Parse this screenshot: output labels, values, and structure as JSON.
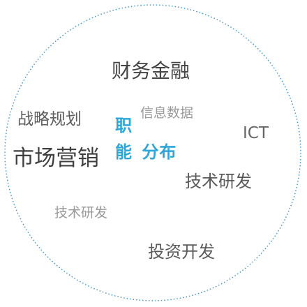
{
  "center": {
    "line1": "职",
    "line2": "能 分布"
  },
  "tags": {
    "finance": "财务金融",
    "strategy": "战略规划",
    "info_data": "信息数据",
    "ict": "ICT",
    "marketing": "市场营销",
    "tech_rd_1": "技术研发",
    "tech_rd_2": "技术研发",
    "investment": "投资开发"
  },
  "colors": {
    "accent": "#2fa6d8",
    "ring": "#3a93c4",
    "text_dark": "#4a4a4a",
    "text_mid": "#666666",
    "text_light": "#9a9a9a"
  }
}
